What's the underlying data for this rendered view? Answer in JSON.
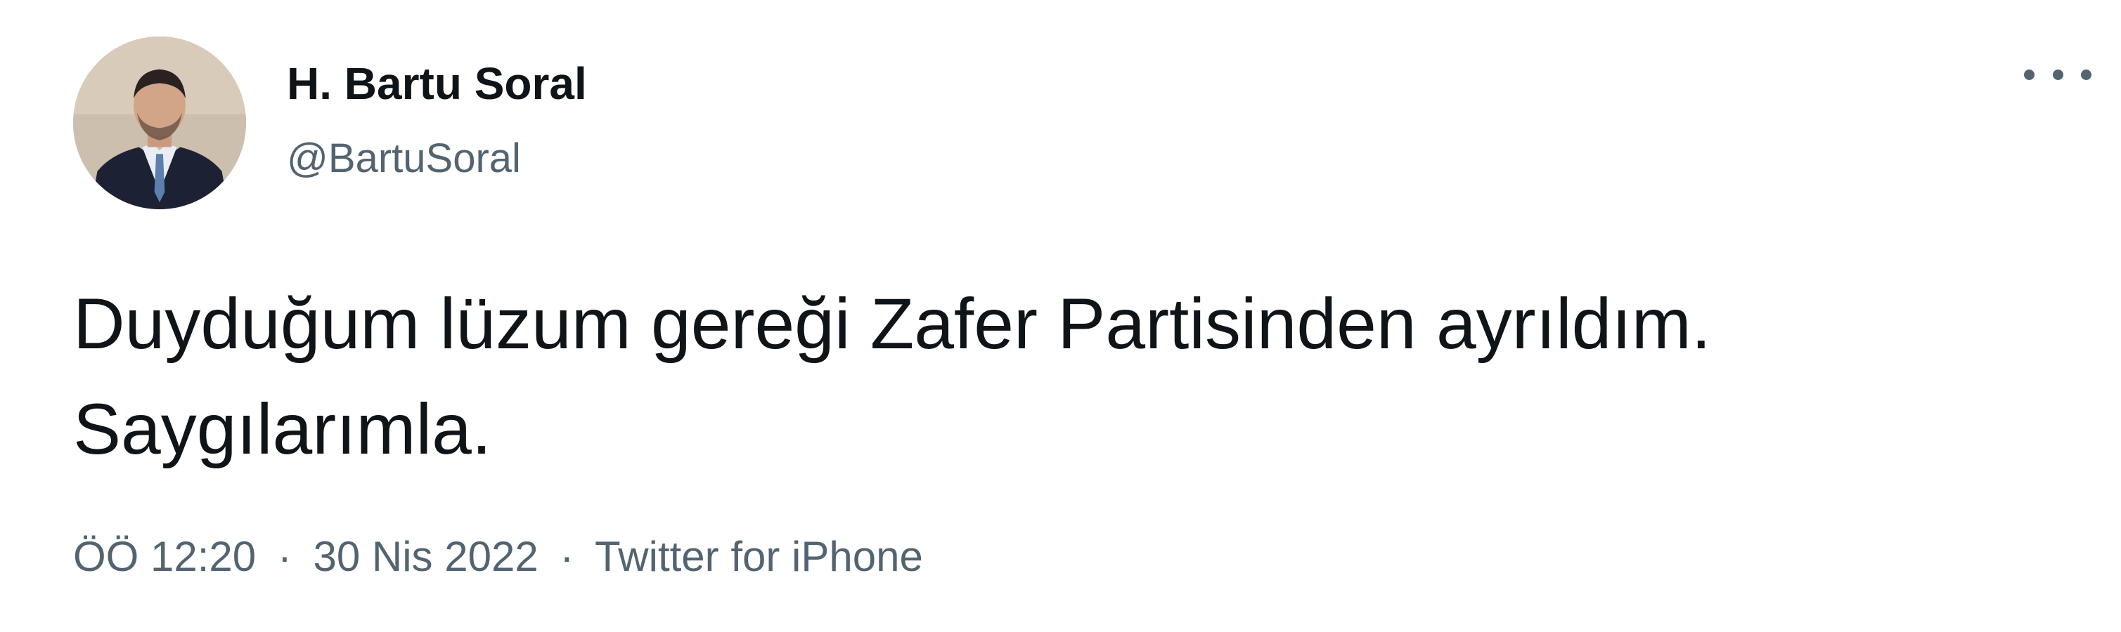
{
  "author": {
    "display_name": "H. Bartu Soral",
    "handle": "@BartuSoral"
  },
  "tweet": {
    "text_lines": [
      "Duyduğum lüzum gereği Zafer Partisinden ayrıldım.",
      "Saygılarımla."
    ]
  },
  "meta": {
    "time": "ÖÖ 12:20",
    "separator": "·",
    "date": "30 Nis 2022",
    "source": "Twitter for iPhone"
  },
  "icons": {
    "more": "more-horizontal-icon"
  },
  "colors": {
    "text_primary": "#0f1419",
    "text_secondary": "#536471",
    "background": "#ffffff"
  }
}
